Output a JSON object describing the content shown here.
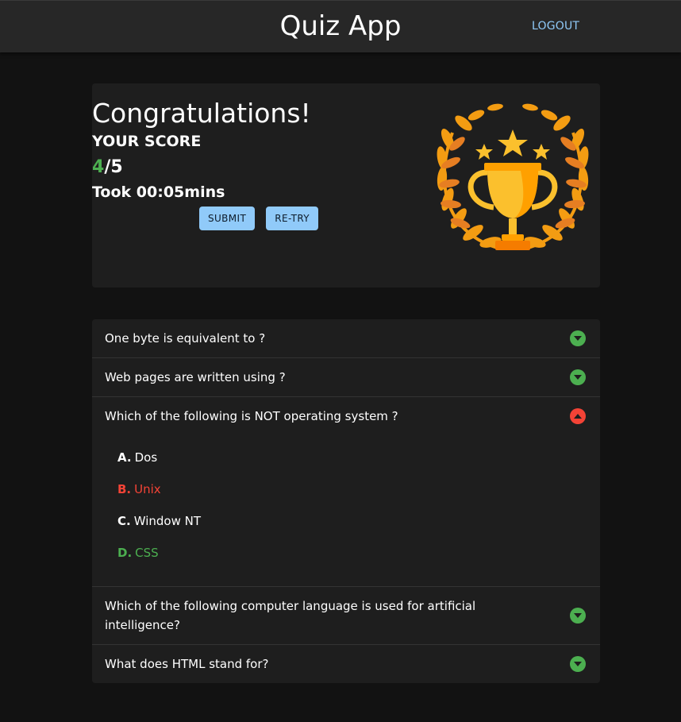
{
  "header": {
    "title": "Quiz App",
    "logout_label": "LOGOUT"
  },
  "result": {
    "heading": "Congratulations!",
    "score_label": "YOUR SCORE",
    "score_correct": "4",
    "score_total": "/5",
    "time_text": "Took 00:05mins",
    "submit_label": "SUBMIT",
    "retry_label": "RE-TRY",
    "trophy_icon": "trophy-laurel-icon"
  },
  "questions": [
    {
      "text": "One byte is equivalent to ?",
      "status": "correct",
      "expanded": false
    },
    {
      "text": "Web pages are written using ?",
      "status": "correct",
      "expanded": false
    },
    {
      "text": "Which of the following is NOT operating system ?",
      "status": "incorrect",
      "expanded": true,
      "options": [
        {
          "letter": "A.",
          "text": "Dos",
          "state": "neutral"
        },
        {
          "letter": "B.",
          "text": "Unix",
          "state": "selected-wrong"
        },
        {
          "letter": "C.",
          "text": "Window NT",
          "state": "neutral"
        },
        {
          "letter": "D.",
          "text": "CSS",
          "state": "correct"
        }
      ]
    },
    {
      "text": "Which of the following computer language is used for artificial intelligence?",
      "status": "correct",
      "expanded": false
    },
    {
      "text": "What does HTML stand for?",
      "status": "correct",
      "expanded": false
    }
  ],
  "colors": {
    "correct": "#4caf50",
    "incorrect": "#f44336",
    "accent": "#90caf9"
  }
}
